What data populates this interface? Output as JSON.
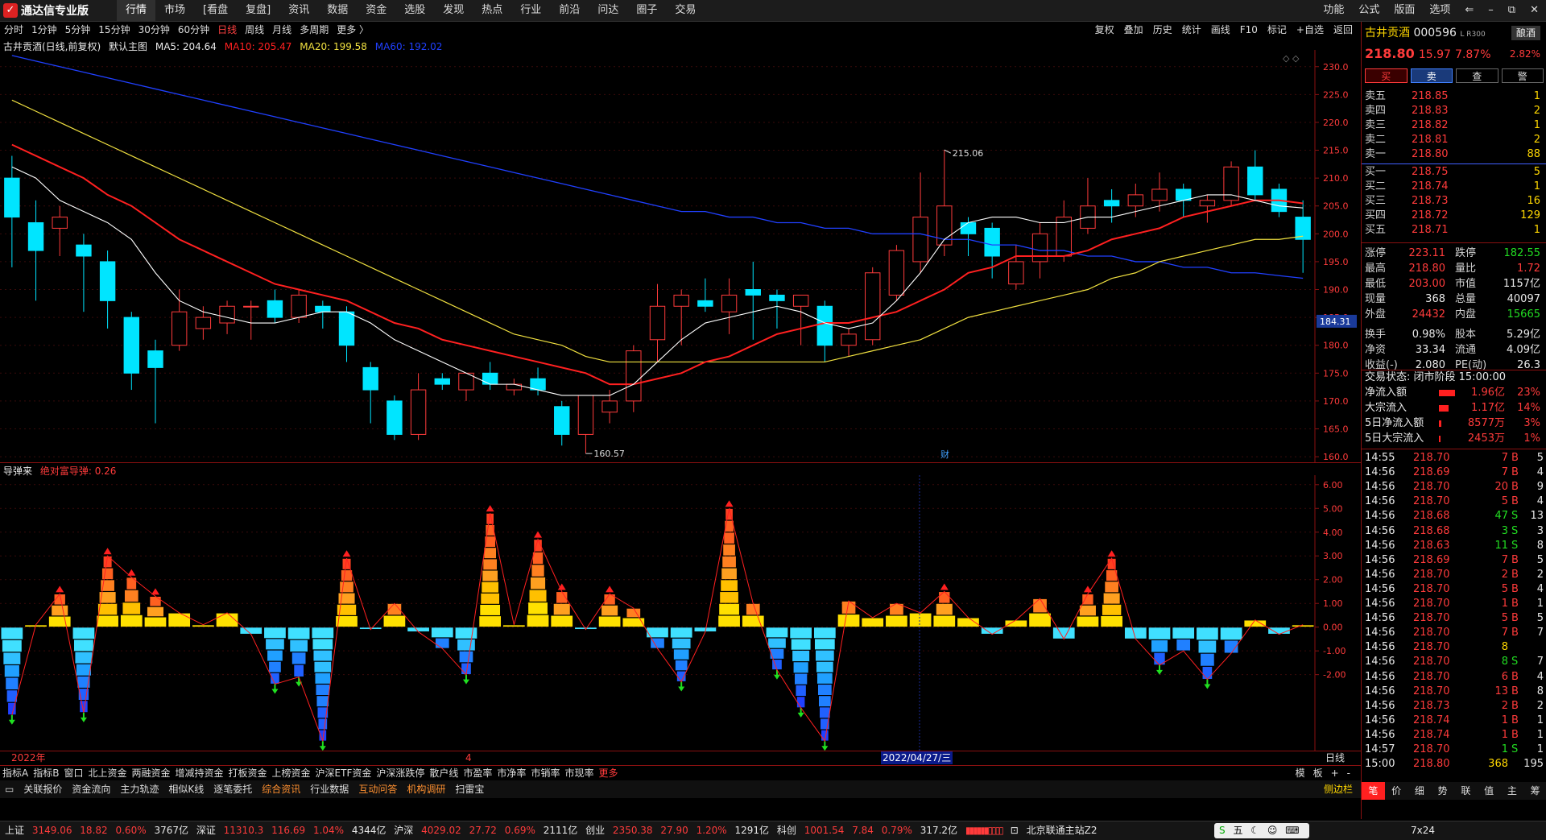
{
  "app": {
    "title": "通达信专业版"
  },
  "menu": [
    "行情",
    "市场",
    "[看盘",
    "复盘]",
    "资讯",
    "数据",
    "资金",
    "选股",
    "发现",
    "热点",
    "行业",
    "前沿",
    "问达",
    "圈子",
    "交易"
  ],
  "menu_right": [
    "功能",
    "公式",
    "版面",
    "选项"
  ],
  "periods": [
    "分时",
    "1分钟",
    "5分钟",
    "15分钟",
    "30分钟",
    "60分钟",
    "日线",
    "周线",
    "月线",
    "多周期",
    "更多 〉"
  ],
  "active_period": "日线",
  "toolbar_right": [
    "复权",
    "叠加",
    "历史",
    "统计",
    "画线",
    "F10",
    "标记",
    "+自选",
    "返回"
  ],
  "legend": {
    "name": "古井贡酒(日线,前复权)",
    "main": "默认主图",
    "ma5": "MA5: 204.64",
    "ma10": "MA10: 205.47",
    "ma20": "MA20: 199.58",
    "ma60": "MA60: 192.02"
  },
  "colors": {
    "up": "#ff3b3b",
    "down": "#00e5ff",
    "ma5": "#ffffff",
    "ma10": "#ff2020",
    "ma20": "#f0e040",
    "ma60": "#2040ff",
    "grid": "#3a0a0a"
  },
  "price_axis": [
    "230.0",
    "225.0",
    "220.0",
    "215.0",
    "210.0",
    "205.0",
    "200.0",
    "195.0",
    "190.0",
    "185.0",
    "180.0",
    "175.0",
    "170.0",
    "165.0",
    "160.0"
  ],
  "price_marker": "184.31",
  "high_label": "215.06",
  "low_label": "160.57",
  "cai_label": "财",
  "indicator": {
    "name": "导弹来",
    "sub": "绝对富导弹: 0.26",
    "axis": [
      "6.00",
      "5.00",
      "4.00",
      "3.00",
      "2.00",
      "1.00",
      "0.00",
      "-1.00",
      "-2.00"
    ]
  },
  "x_labels": {
    "year": "2022年",
    "m4": "4",
    "date": "2022/04/27/三",
    "period": "日线"
  },
  "tabs_row1": [
    "指标A",
    "指标B",
    "窗口",
    "北上资金",
    "两融资金",
    "增减持资金",
    "打板资金",
    "上榜资金",
    "沪深ETF资金",
    "沪深涨跌停",
    "散户线",
    "市盈率",
    "市净率",
    "市销率",
    "市现率",
    "更多"
  ],
  "tabs_row1_right": [
    "模",
    "板",
    "+",
    "-"
  ],
  "tabs_row2": [
    "关联报价",
    "资金流向",
    "主力轨迹",
    "相似K线",
    "逐笔委托",
    "综合资讯",
    "行业数据",
    "互动问答",
    "机构调研",
    "扫雷宝"
  ],
  "tabs_row2_right": "侧边栏",
  "quote": {
    "name": "古井贡酒",
    "code": "000596",
    "tag": "L R300",
    "sector": "酿酒",
    "price": "218.80",
    "change": "15.97",
    "pct": "7.87%",
    "sector_pct": "2.82%",
    "buttons": [
      "买",
      "卖",
      "查",
      "警"
    ],
    "asks": [
      {
        "l": "卖五",
        "p": "218.85",
        "v": "1"
      },
      {
        "l": "卖四",
        "p": "218.83",
        "v": "2"
      },
      {
        "l": "卖三",
        "p": "218.82",
        "v": "1"
      },
      {
        "l": "卖二",
        "p": "218.81",
        "v": "2"
      },
      {
        "l": "卖一",
        "p": "218.80",
        "v": "88"
      }
    ],
    "bids": [
      {
        "l": "买一",
        "p": "218.75",
        "v": "5"
      },
      {
        "l": "买二",
        "p": "218.74",
        "v": "1"
      },
      {
        "l": "买三",
        "p": "218.73",
        "v": "16"
      },
      {
        "l": "买四",
        "p": "218.72",
        "v": "129"
      },
      {
        "l": "买五",
        "p": "218.71",
        "v": "1"
      }
    ],
    "stats": [
      {
        "a": "涨停",
        "av": "223.11",
        "b": "跌停",
        "bv": "182.55"
      },
      {
        "a": "最高",
        "av": "218.80",
        "b": "量比",
        "bv": "1.72"
      },
      {
        "a": "最低",
        "av": "203.00",
        "b": "市值",
        "bv": "1157亿"
      },
      {
        "a": "现量",
        "av": "368",
        "b": "总量",
        "bv": "40097"
      },
      {
        "a": "外盘",
        "av": "24432",
        "b": "内盘",
        "bv": "15665"
      },
      {
        "a": "换手",
        "av": "0.98%",
        "b": "股本",
        "bv": "5.29亿"
      },
      {
        "a": "净资",
        "av": "33.34",
        "b": "流通",
        "bv": "4.09亿"
      },
      {
        "a": "收益(-)",
        "av": "2.080",
        "b": "PE(动)",
        "bv": "26.3"
      }
    ],
    "trade_state": "交易状态: 闭市阶段 15:00:00",
    "flows": [
      {
        "l": "净流入额",
        "v": "1.96亿",
        "p": "23%",
        "f": 0.9
      },
      {
        "l": "大宗流入",
        "v": "1.17亿",
        "p": "14%",
        "f": 0.55
      },
      {
        "l": "5日净流入额",
        "v": "8577万",
        "p": "3%",
        "f": 0.15
      },
      {
        "l": "5日大宗流入",
        "v": "2453万",
        "p": "1%",
        "f": 0.05
      }
    ],
    "ticks": [
      [
        "14:55",
        "218.70",
        "7",
        "B",
        "5"
      ],
      [
        "14:56",
        "218.69",
        "7",
        "B",
        "4"
      ],
      [
        "14:56",
        "218.70",
        "20",
        "B",
        "9"
      ],
      [
        "14:56",
        "218.70",
        "5",
        "B",
        "4"
      ],
      [
        "14:56",
        "218.68",
        "47",
        "S",
        "13"
      ],
      [
        "14:56",
        "218.68",
        "3",
        "S",
        "3"
      ],
      [
        "14:56",
        "218.63",
        "11",
        "S",
        "8"
      ],
      [
        "14:56",
        "218.69",
        "7",
        "B",
        "5"
      ],
      [
        "14:56",
        "218.70",
        "2",
        "B",
        "2"
      ],
      [
        "14:56",
        "218.70",
        "5",
        "B",
        "4"
      ],
      [
        "14:56",
        "218.70",
        "1",
        "B",
        "1"
      ],
      [
        "14:56",
        "218.70",
        "5",
        "B",
        "5"
      ],
      [
        "14:56",
        "218.70",
        "7",
        "B",
        "7"
      ],
      [
        "14:56",
        "218.70",
        "8",
        "",
        ""
      ],
      [
        "14:56",
        "218.70",
        "8",
        "S",
        "7"
      ],
      [
        "14:56",
        "218.70",
        "6",
        "B",
        "4"
      ],
      [
        "14:56",
        "218.70",
        "13",
        "B",
        "8"
      ],
      [
        "14:56",
        "218.73",
        "2",
        "B",
        "2"
      ],
      [
        "14:56",
        "218.74",
        "1",
        "B",
        "1"
      ],
      [
        "14:56",
        "218.74",
        "1",
        "B",
        "1"
      ],
      [
        "14:57",
        "218.70",
        "1",
        "S",
        "1"
      ],
      [
        "15:00",
        "218.80",
        "368",
        "",
        "195"
      ]
    ],
    "side_tabs": [
      "笔",
      "价",
      "细",
      "势",
      "联",
      "值",
      "主",
      "筹"
    ]
  },
  "status": {
    "sh": "上证",
    "sh_v": "3149.06",
    "sh_c": "18.82",
    "sh_p": "0.60%",
    "sh_a": "3767亿",
    "sz": "深证",
    "sz_v": "11310.3",
    "sz_c": "116.69",
    "sz_p": "1.04%",
    "sz_a": "4344亿",
    "hs": "沪深",
    "hs_v": "4029.02",
    "hs_c": "27.72",
    "hs_p": "0.69%",
    "hs_a": "2111亿",
    "cy": "创业",
    "cy_v": "2350.38",
    "cy_c": "27.90",
    "cy_p": "1.20%",
    "cy_a": "1291亿",
    "kc": "科创",
    "kc_v": "1001.54",
    "kc_c": "7.84",
    "kc_p": "0.79%",
    "kc_a": "317.2亿",
    "server": "北京联通主站Z2",
    "ime": "五",
    "hours": "7x24"
  },
  "chart_data": {
    "type": "candlestick",
    "title": "古井贡酒(日线,前复权)",
    "ylim": [
      159,
      233
    ],
    "candles": [
      {
        "o": 210,
        "h": 214,
        "l": 194,
        "c": 203
      },
      {
        "o": 202,
        "h": 206,
        "l": 188,
        "c": 197
      },
      {
        "o": 201,
        "h": 205,
        "l": 196,
        "c": 203
      },
      {
        "o": 198,
        "h": 200,
        "l": 186,
        "c": 196
      },
      {
        "o": 195,
        "h": 197,
        "l": 183,
        "c": 188
      },
      {
        "o": 185,
        "h": 186,
        "l": 172,
        "c": 175
      },
      {
        "o": 179,
        "h": 181,
        "l": 166,
        "c": 176
      },
      {
        "o": 180,
        "h": 190,
        "l": 179,
        "c": 186
      },
      {
        "o": 183,
        "h": 187,
        "l": 181,
        "c": 185
      },
      {
        "o": 184,
        "h": 188,
        "l": 182,
        "c": 187
      },
      {
        "o": 187,
        "h": 188,
        "l": 181,
        "c": 187
      },
      {
        "o": 188,
        "h": 190,
        "l": 184,
        "c": 185
      },
      {
        "o": 185,
        "h": 190,
        "l": 184,
        "c": 189
      },
      {
        "o": 187,
        "h": 188,
        "l": 183,
        "c": 186
      },
      {
        "o": 186,
        "h": 187,
        "l": 177,
        "c": 180
      },
      {
        "o": 176,
        "h": 177,
        "l": 166,
        "c": 172
      },
      {
        "o": 170,
        "h": 171,
        "l": 163,
        "c": 164
      },
      {
        "o": 164,
        "h": 175,
        "l": 163,
        "c": 172
      },
      {
        "o": 174,
        "h": 175,
        "l": 172,
        "c": 173
      },
      {
        "o": 172,
        "h": 175,
        "l": 170,
        "c": 175
      },
      {
        "o": 175,
        "h": 177,
        "l": 172,
        "c": 173
      },
      {
        "o": 172,
        "h": 174,
        "l": 171,
        "c": 173
      },
      {
        "o": 174,
        "h": 176,
        "l": 171,
        "c": 172
      },
      {
        "o": 169,
        "h": 170,
        "l": 162,
        "c": 164
      },
      {
        "o": 164,
        "h": 171,
        "l": 160.57,
        "c": 171
      },
      {
        "o": 168,
        "h": 172,
        "l": 166,
        "c": 170
      },
      {
        "o": 170,
        "h": 180,
        "l": 168,
        "c": 179
      },
      {
        "o": 181,
        "h": 191,
        "l": 177,
        "c": 187
      },
      {
        "o": 187,
        "h": 190,
        "l": 180,
        "c": 189
      },
      {
        "o": 188,
        "h": 192,
        "l": 186,
        "c": 187
      },
      {
        "o": 186,
        "h": 192,
        "l": 182,
        "c": 189
      },
      {
        "o": 190,
        "h": 195,
        "l": 181,
        "c": 189
      },
      {
        "o": 189,
        "h": 190,
        "l": 183,
        "c": 188
      },
      {
        "o": 187,
        "h": 189,
        "l": 180,
        "c": 189
      },
      {
        "o": 187,
        "h": 188,
        "l": 177,
        "c": 180
      },
      {
        "o": 180,
        "h": 183,
        "l": 178,
        "c": 182
      },
      {
        "o": 181,
        "h": 194,
        "l": 180,
        "c": 193
      },
      {
        "o": 189,
        "h": 198,
        "l": 188,
        "c": 197
      },
      {
        "o": 195,
        "h": 211,
        "l": 193,
        "c": 203
      },
      {
        "o": 198,
        "h": 215.06,
        "l": 196,
        "c": 205
      },
      {
        "o": 202,
        "h": 203,
        "l": 196,
        "c": 200
      },
      {
        "o": 201,
        "h": 202,
        "l": 192,
        "c": 196
      },
      {
        "o": 191,
        "h": 198,
        "l": 190,
        "c": 195
      },
      {
        "o": 195,
        "h": 202,
        "l": 192,
        "c": 200
      },
      {
        "o": 196,
        "h": 206,
        "l": 195,
        "c": 203
      },
      {
        "o": 201,
        "h": 210,
        "l": 200,
        "c": 205
      },
      {
        "o": 206,
        "h": 208,
        "l": 202,
        "c": 205
      },
      {
        "o": 205,
        "h": 209,
        "l": 203,
        "c": 207
      },
      {
        "o": 206,
        "h": 211,
        "l": 204,
        "c": 208
      },
      {
        "o": 208,
        "h": 209,
        "l": 203,
        "c": 206
      },
      {
        "o": 205,
        "h": 207,
        "l": 202,
        "c": 206
      },
      {
        "o": 206,
        "h": 213,
        "l": 205,
        "c": 212
      },
      {
        "o": 212,
        "h": 215,
        "l": 206,
        "c": 207
      },
      {
        "o": 208,
        "h": 209,
        "l": 203,
        "c": 204
      },
      {
        "o": 203,
        "h": 206,
        "l": 193,
        "c": 199
      }
    ],
    "ma5": [
      212,
      210,
      206,
      204,
      202,
      199,
      193,
      188,
      186,
      185,
      184,
      184,
      185,
      186,
      186,
      184,
      181,
      179,
      177,
      175,
      173,
      173,
      172,
      171,
      171,
      171,
      173,
      177,
      181,
      184,
      185,
      186,
      187,
      186,
      184,
      183,
      184,
      188,
      193,
      199,
      202,
      203,
      203,
      202,
      202,
      203,
      203,
      204,
      205,
      206,
      207,
      207,
      206,
      205,
      204.64
    ],
    "ma10": [
      216,
      214,
      212,
      210,
      207,
      205,
      202,
      199,
      197,
      195,
      193,
      191,
      190,
      189,
      188,
      186,
      184,
      183,
      181,
      180,
      179,
      178,
      177,
      176,
      175,
      173,
      173,
      174,
      175,
      177,
      178,
      180,
      182,
      183,
      184,
      184,
      185,
      186,
      188,
      190,
      193,
      194,
      196,
      196,
      196,
      197,
      199,
      200,
      201,
      203,
      204,
      205,
      206,
      206,
      205.47
    ],
    "ma20": [
      224,
      222,
      220,
      218,
      216,
      214,
      212,
      210,
      208,
      206,
      204,
      202,
      200,
      198,
      196,
      194,
      192,
      190,
      188,
      186,
      184,
      182,
      181,
      180,
      178,
      177,
      177,
      177,
      177,
      177,
      177,
      177,
      177,
      177,
      177,
      178,
      179,
      180,
      181,
      183,
      185,
      186,
      187,
      188,
      189,
      190,
      192,
      193,
      195,
      196,
      197,
      198,
      199,
      199,
      199.58
    ],
    "ma60": [
      232,
      231,
      230,
      229,
      228,
      227,
      226,
      225,
      224,
      223,
      222,
      221,
      220,
      219,
      218,
      217,
      216,
      215,
      214,
      213,
      212,
      211,
      210,
      209,
      208,
      207,
      206,
      205,
      204,
      204,
      203,
      203,
      202,
      202,
      201,
      201,
      200,
      200,
      200,
      199,
      199,
      198,
      198,
      197,
      197,
      196,
      196,
      195,
      195,
      194,
      194,
      193,
      193,
      192.5,
      192.02
    ],
    "indicator_values": [
      -3.7,
      0.1,
      1.4,
      -3.6,
      3.0,
      2.1,
      1.3,
      0.6,
      0.1,
      0.6,
      -0.3,
      -2.4,
      -2.1,
      -4.8,
      2.9,
      -0.1,
      1.0,
      -0.2,
      -0.9,
      -2.0,
      4.8,
      0.1,
      3.7,
      1.5,
      -0.1,
      1.4,
      0.8,
      -0.9,
      -2.3,
      -0.2,
      5.0,
      1.0,
      -1.8,
      -3.4,
      -4.8,
      1.1,
      0.4,
      1.0,
      0.6,
      1.5,
      0.4,
      -0.3,
      0.3,
      1.2,
      -0.5,
      1.4,
      2.9,
      -0.5,
      -1.6,
      -1.0,
      -2.2,
      -1.1,
      0.3,
      -0.3,
      0.1
    ],
    "indicator_ylim": [
      -5.2,
      6.4
    ]
  }
}
